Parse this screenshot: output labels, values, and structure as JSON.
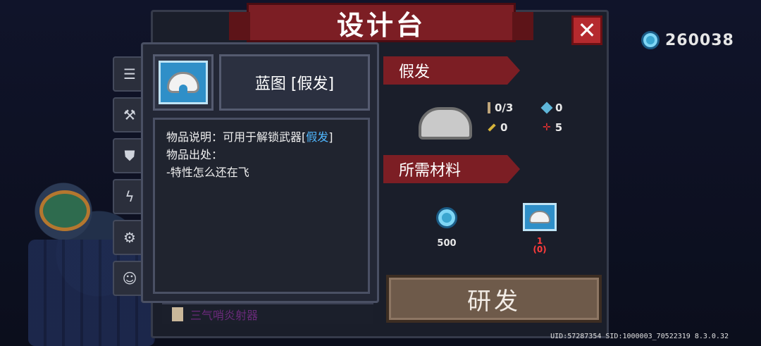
{
  "title": "设计台",
  "currency": {
    "icon": "gem-icon",
    "value": "260038",
    "color": "#3aa6d0"
  },
  "side_tabs": [
    {
      "icon": "list-icon",
      "glyph": "☰"
    },
    {
      "icon": "hammer-icon",
      "glyph": "⚒"
    },
    {
      "icon": "armor-icon",
      "glyph": "⛊"
    },
    {
      "icon": "lightning-icon",
      "glyph": "ϟ"
    },
    {
      "icon": "gear-icon",
      "glyph": "⚙"
    },
    {
      "icon": "character-icon",
      "glyph": "☺"
    }
  ],
  "detail": {
    "name": "蓝图 [假发]",
    "desc_line1_prefix": "物品说明：可用于解锁武器[",
    "desc_line1_link": "假发",
    "desc_line1_suffix": "]",
    "desc_line2": "物品出处：",
    "desc_line3": "-特性怎么还在飞"
  },
  "weapon": {
    "name": "假发",
    "stats": {
      "attack": "0/3",
      "energy": "0",
      "crit": "0",
      "accuracy": "5"
    }
  },
  "materials_header": "所需材料",
  "materials": [
    {
      "name": "gem",
      "count": "500"
    },
    {
      "name": "blueprint",
      "count": "1",
      "owned": "(0)"
    }
  ],
  "research_button": "研发",
  "list_peek_text": "三气哨炎射器",
  "uid_text": "UID:57287354 SID:1000003_70522319 8.3.0.32",
  "colors": {
    "banner": "#7c1e24",
    "close": "#b52a2e",
    "link": "#4fb7ff",
    "shortage": "#ff3b3b"
  }
}
